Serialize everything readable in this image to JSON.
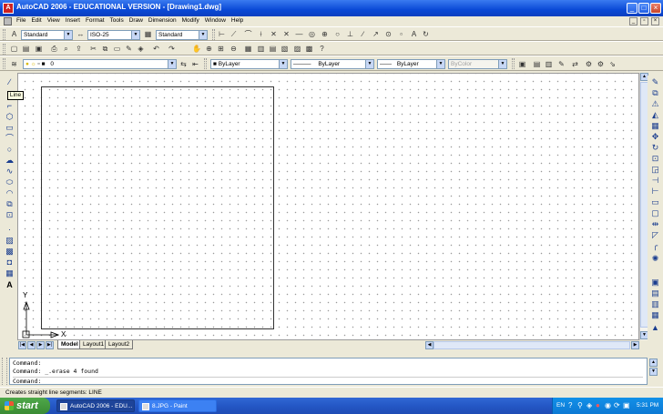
{
  "window": {
    "title": "AutoCAD 2006 - EDUCATIONAL VERSION - [Drawing1.dwg]",
    "app_icon_glyph": "A",
    "minimize_glyph": "_",
    "maximize_glyph": "□",
    "close_glyph": "×"
  },
  "menubar": {
    "items": [
      "File",
      "Edit",
      "View",
      "Insert",
      "Format",
      "Tools",
      "Draw",
      "Dimension",
      "Modify",
      "Window",
      "Help"
    ],
    "mdi_min_glyph": "_",
    "mdi_restore_glyph": "▫",
    "mdi_close_glyph": "×"
  },
  "styles_toolbar": {
    "text_style": "Standard",
    "dim_style": "ISO-25",
    "table_style": "Standard"
  },
  "layers_toolbar": {
    "layer_name": "0",
    "color": "ByLayer",
    "linetype": "ByLayer",
    "lineweight": "ByLayer",
    "plot_style": "ByColor"
  },
  "tooltip": {
    "text": "Line"
  },
  "ucs": {
    "y_label": "Y",
    "x_label": "X"
  },
  "tabs": {
    "nav_glyphs": [
      "|◀",
      "◀",
      "▶",
      "▶|"
    ],
    "items": [
      "Model",
      "Layout1",
      "Layout2"
    ]
  },
  "scroll_glyphs": {
    "left": "◀",
    "right": "▶",
    "up": "▲",
    "down": "▼"
  },
  "command_lines": [
    "Command:",
    "Command: _.erase 4 found",
    "Command:"
  ],
  "status": {
    "text": "Creates straight line segments:  LINE"
  },
  "taskbar": {
    "start_label": "start",
    "items": [
      {
        "label": "AutoCAD 2006 - EDU...",
        "active": true
      },
      {
        "label": "8.JPG - Paint",
        "active": false
      }
    ],
    "tray_lang": "EN",
    "clock": "5:31 PM"
  },
  "colors": {
    "titlebar": "#0a49d6",
    "taskbar": "#2457c5",
    "start_button": "#3a8b34",
    "canvas": "#ffffff",
    "chrome": "#ece9d8"
  }
}
